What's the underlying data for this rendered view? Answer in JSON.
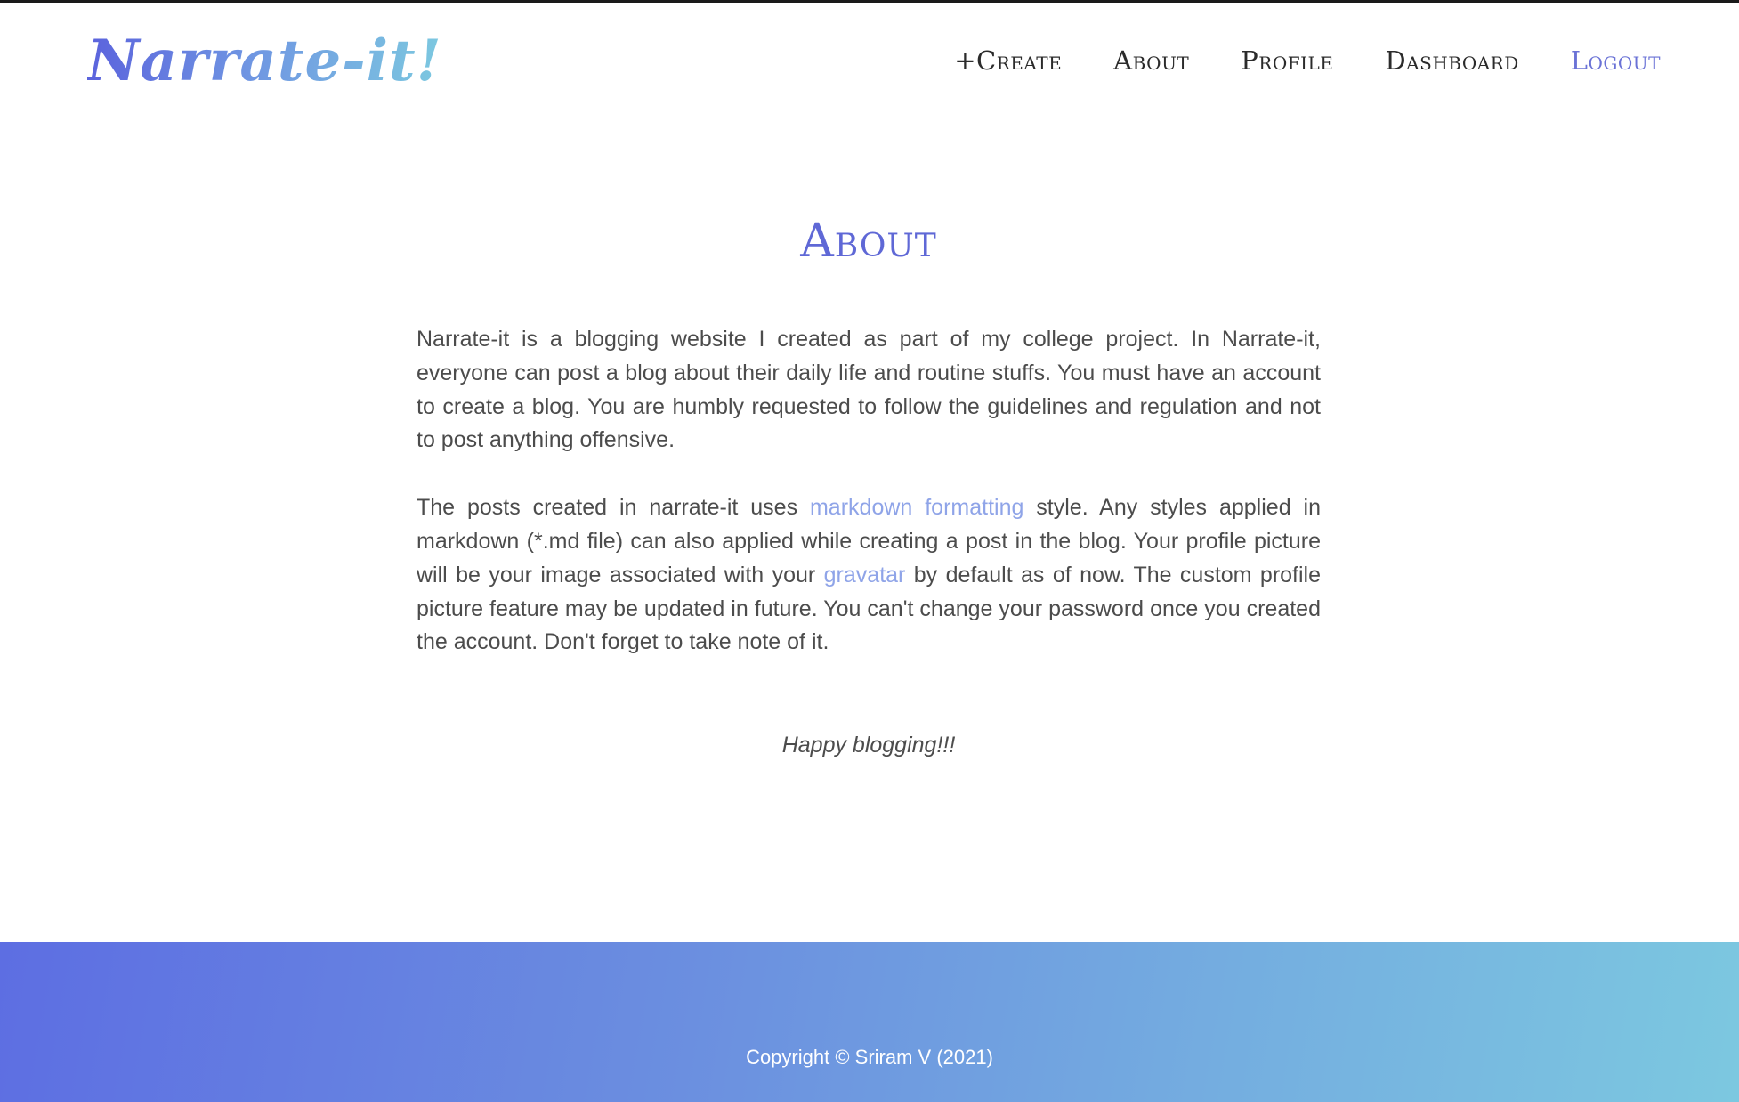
{
  "header": {
    "logo_text": "Narrate-it!",
    "nav": {
      "create": "+Create",
      "about": "About",
      "profile": "Profile",
      "dashboard": "Dashboard",
      "logout": "Logout"
    }
  },
  "main": {
    "title": "About",
    "p1": "Narrate-it is a blogging website I created as part of my college project. In Narrate-it, everyone can post a blog about their daily life and routine stuffs. You must have an account to create a blog. You are humbly requested to follow the guidelines and regulation and not to post anything offensive.",
    "p2_part1": "The posts created in narrate-it uses ",
    "p2_link1": "markdown formatting",
    "p2_part2": " style. Any styles applied in markdown (*.md file) can also applied while creating a post in the blog. Your profile picture will be your image associated with your ",
    "p2_link2": "gravatar",
    "p2_part3": " by default as of now. The custom profile picture feature may be updated in future. You can't change your password once you created the account. Don't forget to take note of it.",
    "closing": "Happy blogging!!!"
  },
  "footer": {
    "copyright": "Copyright © Sriram V (2021)"
  },
  "colors": {
    "accent": "#5f68d6",
    "link": "#8fa4e8",
    "footer_gradient_start": "#5d6ee2",
    "footer_gradient_end": "#7cc8e0"
  }
}
